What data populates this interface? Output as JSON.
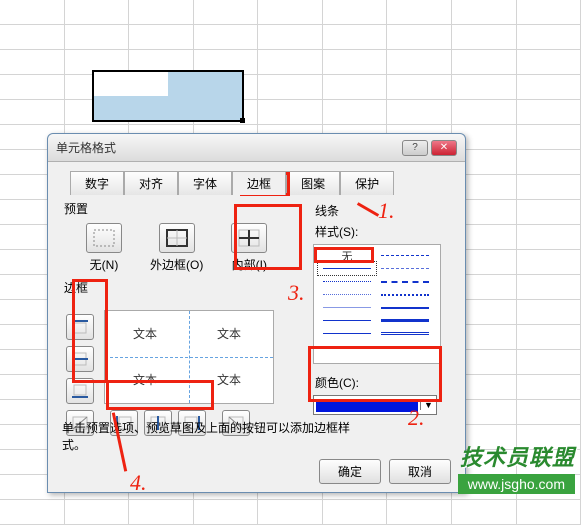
{
  "dialog": {
    "title": "单元格格式",
    "tabs": [
      "数字",
      "对齐",
      "字体",
      "边框",
      "图案",
      "保护"
    ],
    "active_tab": 3,
    "preset_label": "预置",
    "presets": [
      {
        "label": "无(N)"
      },
      {
        "label": "外边框(O)"
      },
      {
        "label": "内部(I)"
      }
    ],
    "border_label": "边框",
    "preview_text": "文本",
    "line_label": "线条",
    "style_label": "样式(S):",
    "style_none": "无",
    "color_label": "颜色(C):",
    "selected_color": "#0016dd",
    "hint": "单击预置选项、预览草图及上面的按钮可以添加边框样式。",
    "ok": "确定",
    "cancel": "取消"
  },
  "annotations": {
    "a1": "1.",
    "a2": "2.",
    "a3": "3.",
    "a4": "4."
  },
  "watermark": {
    "line1": "技术员联盟",
    "line2": "www.jsgho.com"
  }
}
